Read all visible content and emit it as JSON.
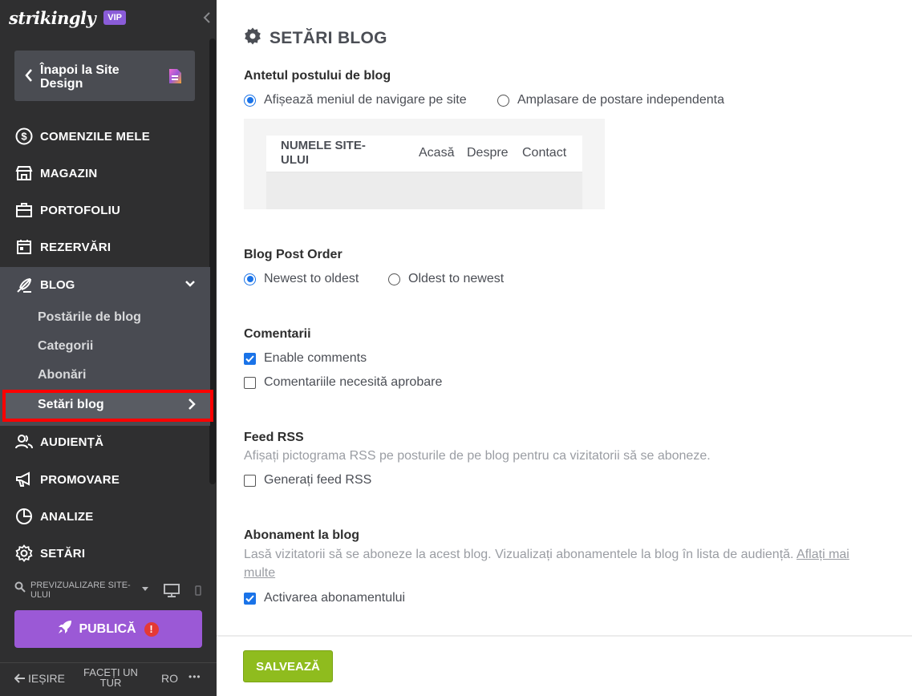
{
  "sidebar": {
    "logo": "strikingly",
    "vip_badge": "VIP",
    "back_label": "Înapoi la Site Design",
    "nav": [
      {
        "label": "COMENZILE MELE",
        "icon": "dollar-circle-icon"
      },
      {
        "label": "MAGAZIN",
        "icon": "store-icon"
      },
      {
        "label": "PORTOFOLIU",
        "icon": "briefcase-icon"
      },
      {
        "label": "REZERVĂRI",
        "icon": "calendar-icon"
      }
    ],
    "blog": {
      "label": "BLOG",
      "icon": "quill-icon",
      "sub_items": [
        "Postările de blog",
        "Categorii",
        "Abonări"
      ],
      "active_item": "Setări blog"
    },
    "nav_bottom": [
      {
        "label": "AUDIENȚĂ",
        "icon": "audience-icon"
      },
      {
        "label": "PROMOVARE",
        "icon": "megaphone-icon"
      },
      {
        "label": "ANALIZE",
        "icon": "pie-chart-icon"
      },
      {
        "label": "SETĂRI",
        "icon": "gear-icon"
      }
    ],
    "preview_label": "PREVIZUALIZARE SITE-ULUI",
    "publish_label": "PUBLICĂ",
    "publish_alert": "!",
    "footer": {
      "exit": "IEȘIRE",
      "tour": "FACEȚI UN TUR",
      "lang": "RO",
      "more": "•••"
    }
  },
  "main": {
    "title": "SETĂRI BLOG",
    "header_section": {
      "title": "Antetul postului de blog",
      "options": [
        "Afișează meniul de navigare pe site",
        "Amplasare de postare independenta"
      ],
      "selected": 0,
      "preview": {
        "site_name": "NUMELE SITE-ULUI",
        "links": [
          "Acasă",
          "Despre",
          "Contact"
        ]
      }
    },
    "order_section": {
      "title": "Blog Post Order",
      "options": [
        "Newest to oldest",
        "Oldest to newest"
      ],
      "selected": 0
    },
    "comments_section": {
      "title": "Comentarii",
      "enable_comments": "Enable comments",
      "enable_comments_checked": true,
      "require_approval": "Comentariile necesită aprobare",
      "require_approval_checked": false
    },
    "rss_section": {
      "title": "Feed RSS",
      "description": "Afișați pictograma RSS pe posturile de pe blog pentru ca vizitatorii să se aboneze.",
      "generate": "Generați feed RSS",
      "generate_checked": false
    },
    "subscription_section": {
      "title": "Abonament la blog",
      "description": "Lasă vizitatorii să se aboneze la acest blog. Vizualizați abonamentele la blog în lista de audiență.",
      "learn_more": "Aflați mai multe",
      "activate": "Activarea abonamentului",
      "activate_checked": true
    },
    "save_label": "SALVEAZĂ"
  },
  "colors": {
    "sidebar_bg": "#2f2f30",
    "sidebar_active_bg": "#494b52",
    "highlight_border": "#ff0000",
    "publish": "#9b59d6",
    "save": "#8fbc1e",
    "accent_blue": "#1a73e8"
  }
}
